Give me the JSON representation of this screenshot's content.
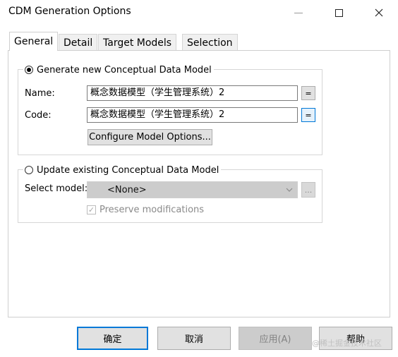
{
  "window": {
    "title": "CDM Generation Options"
  },
  "tabs": [
    "General",
    "Detail",
    "Target Models",
    "Selection"
  ],
  "generate_new": {
    "label": "Generate new Conceptual Data Model",
    "name_label": "Name:",
    "name_value": "概念数据模型（学生管理系统）2",
    "code_label": "Code:",
    "code_value": "概念数据模型（学生管理系统）2",
    "equals_symbol": "=",
    "configure_label": "Configure Model Options..."
  },
  "update_existing": {
    "label": "Update existing Conceptual Data Model",
    "select_label": "Select model:",
    "select_value": "<None>",
    "browse_label": "...",
    "preserve_label": "Preserve modifications"
  },
  "buttons": {
    "ok": "确定",
    "cancel": "取消",
    "apply": "应用(A)",
    "help": "帮助"
  },
  "watermark": "@稀土掘金技术社区",
  "colors": {
    "focus": "#0078d7",
    "disabled_bg": "#cccccc"
  }
}
